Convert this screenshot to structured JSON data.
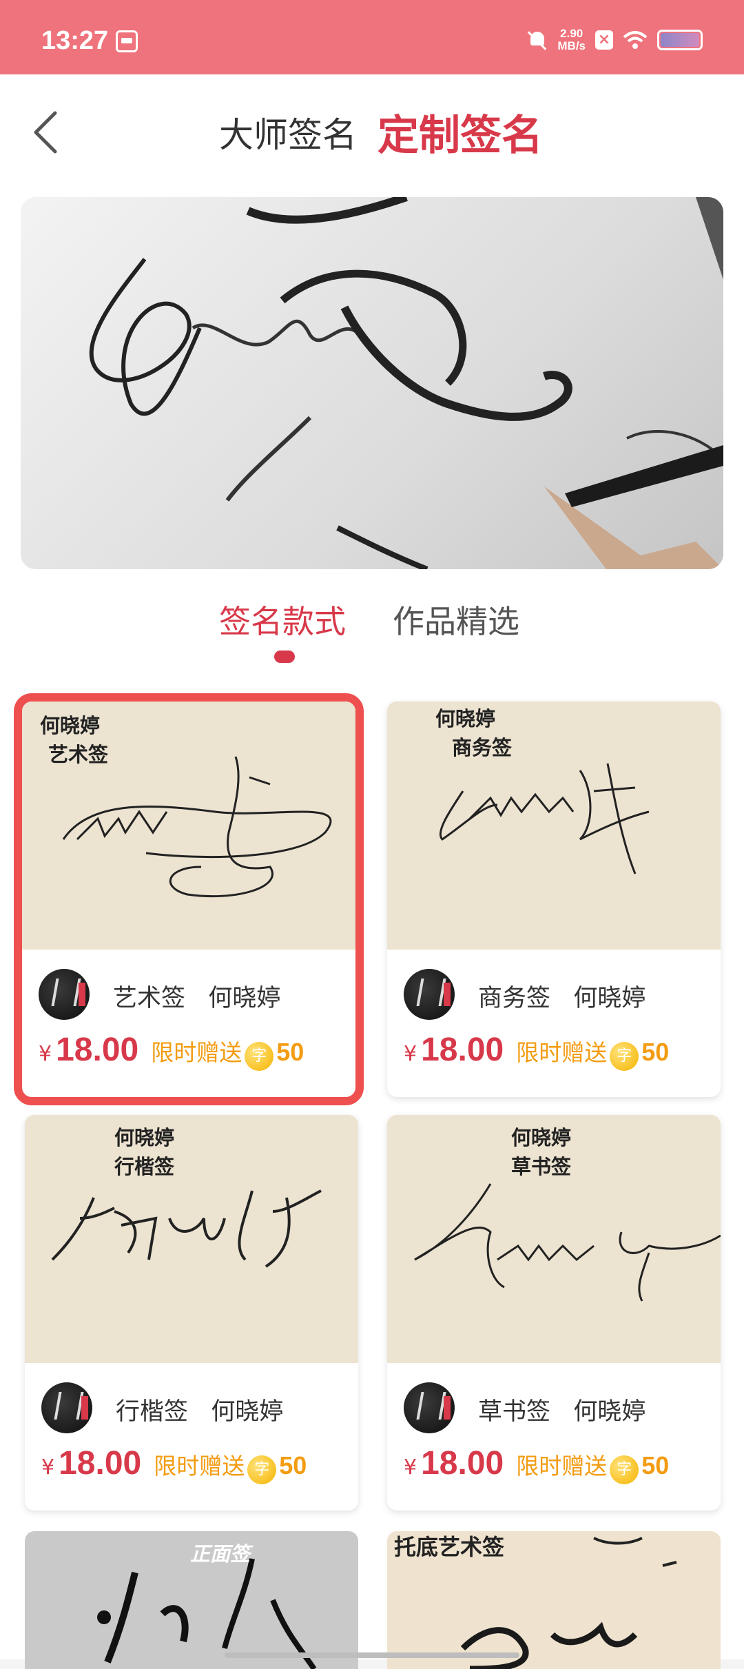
{
  "status_bar": {
    "time": "13:27",
    "speed_value": "2.90",
    "speed_unit": "MB/s"
  },
  "header": {
    "tab_master": "大师签名",
    "tab_custom": "定制签名"
  },
  "segments": {
    "style": "签名款式",
    "works": "作品精选"
  },
  "cards": [
    {
      "img_name": "何晓婷",
      "img_type": "艺术签",
      "style": "艺术签",
      "author": "何晓婷",
      "currency": "¥",
      "price": "18.00",
      "promo": "限时赠送",
      "coin_glyph": "字",
      "coin_amount": "50"
    },
    {
      "img_name": "何晓婷",
      "img_type": "商务签",
      "style": "商务签",
      "author": "何晓婷",
      "currency": "¥",
      "price": "18.00",
      "promo": "限时赠送",
      "coin_glyph": "字",
      "coin_amount": "50"
    },
    {
      "img_name": "何晓婷",
      "img_type": "行楷签",
      "style": "行楷签",
      "author": "何晓婷",
      "currency": "¥",
      "price": "18.00",
      "promo": "限时赠送",
      "coin_glyph": "字",
      "coin_amount": "50"
    },
    {
      "img_name": "何晓婷",
      "img_type": "草书签",
      "style": "草书签",
      "author": "何晓婷",
      "currency": "¥",
      "price": "18.00",
      "promo": "限时赠送",
      "coin_glyph": "字",
      "coin_amount": "50"
    }
  ],
  "bottom_cards": [
    {
      "label": "正面签"
    },
    {
      "label": "托底艺术签"
    }
  ]
}
